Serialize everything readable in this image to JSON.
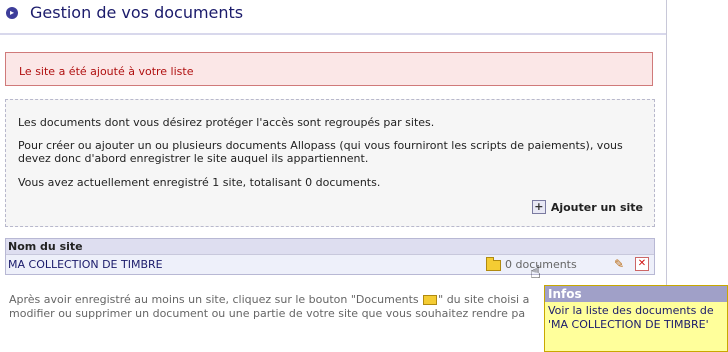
{
  "header": {
    "title": "Gestion de vos documents",
    "bullet_icon": "circle-bullet-icon"
  },
  "alert": {
    "message": "Le site a été ajouté à votre liste"
  },
  "info": {
    "line1": "Les documents dont vous désirez protéger l'accès sont regroupés par sites.",
    "line2": "Pour créer ou ajouter un ou plusieurs documents Allopass (qui vous fourniront les scripts de paiements), vous devez donc d'abord enregistrer le site auquel ils appartiennent.",
    "line3": "Vous avez actuellement enregistré 1 site, totalisant 0 documents.",
    "add_site_label": "Ajouter un site"
  },
  "table": {
    "header": "Nom du site",
    "rows": [
      {
        "site_name": "MA COLLECTION DE TIMBRE",
        "documents_label": "0 documents"
      }
    ]
  },
  "footer": {
    "text_before": "Après avoir enregistré au moins un site, cliquez sur le bouton \"Documents ",
    "text_after": "\" du site choisi a",
    "line2": "modifier ou supprimer un document ou une partie de votre site que vous souhaitez rendre pa"
  },
  "tooltip": {
    "title": "Infos",
    "body": "Voir la liste des documents de 'MA COLLECTION DE TIMBRE'"
  },
  "colors": {
    "title": "#1b1b6b",
    "alert_text": "#b01010",
    "alert_bg": "#fbe7e7",
    "tooltip_head": "#a0a0c8",
    "tooltip_body": "#ffff9b"
  }
}
